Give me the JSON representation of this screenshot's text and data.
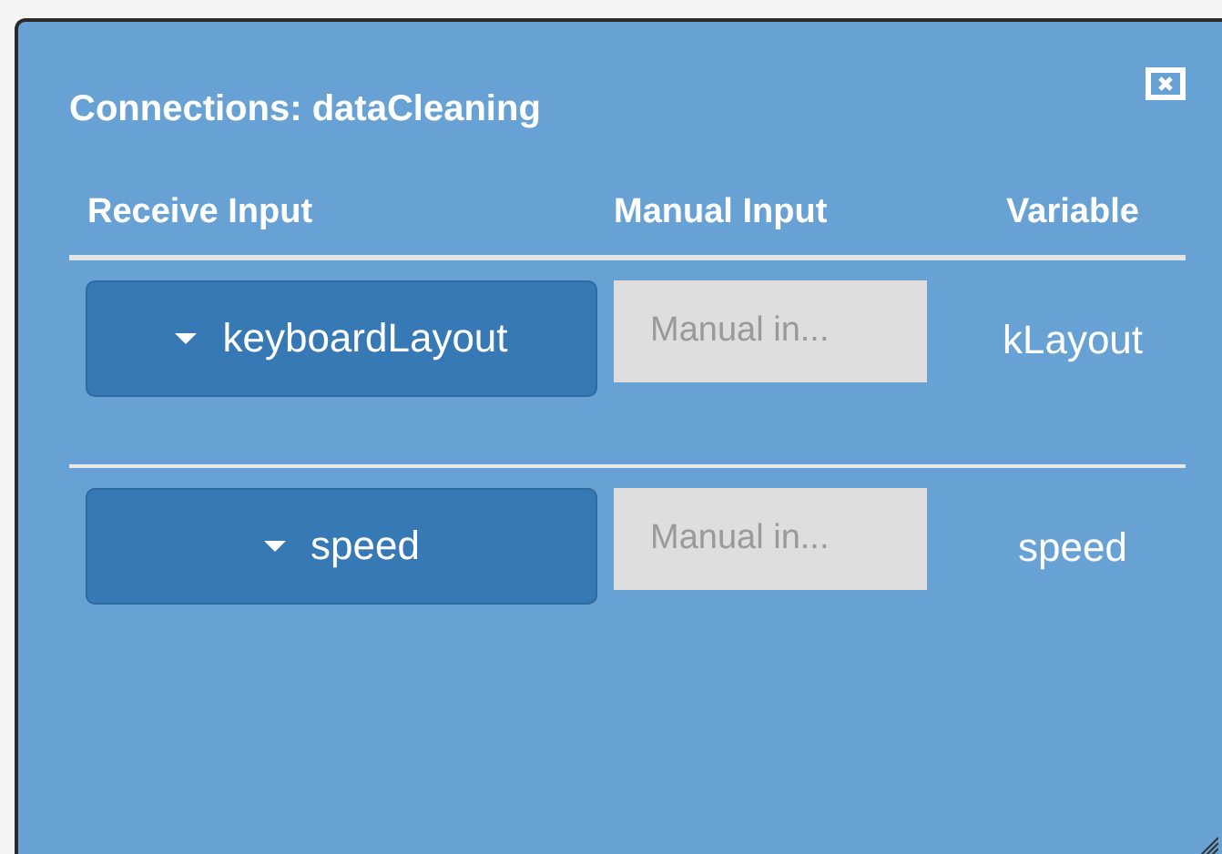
{
  "dialog": {
    "title": "Connections: dataCleaning"
  },
  "columns": [
    "Receive Input",
    "Manual Input",
    "Variable"
  ],
  "rows": [
    {
      "input": "keyboardLayout",
      "manual_placeholder": "Manual in...",
      "variable": "kLayout"
    },
    {
      "input": "speed",
      "manual_placeholder": "Manual in...",
      "variable": "speed"
    }
  ]
}
